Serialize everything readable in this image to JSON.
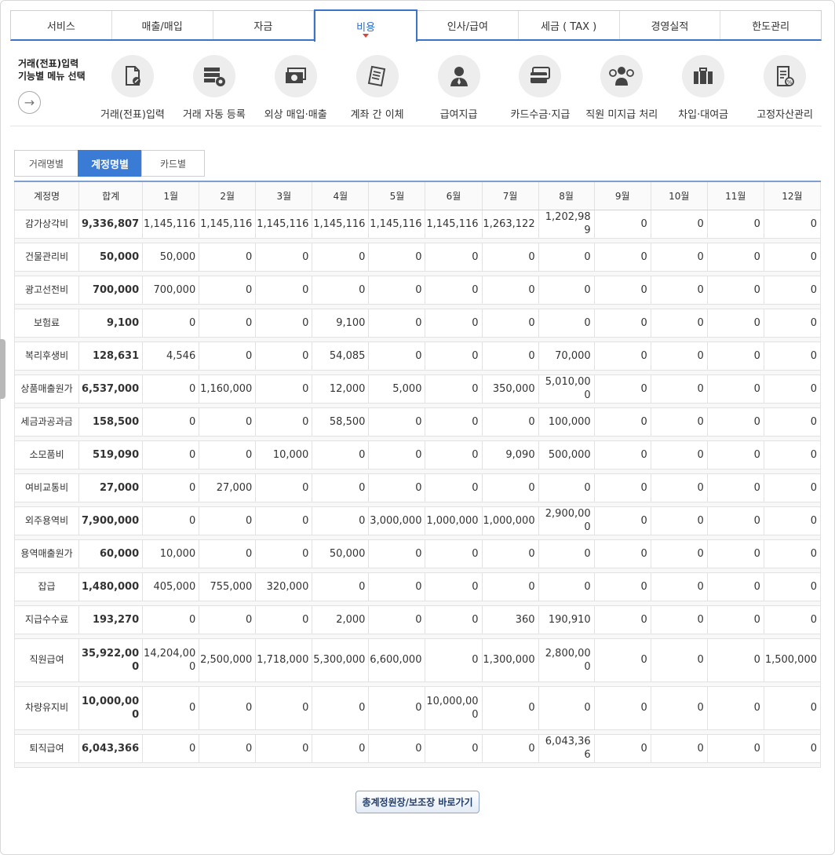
{
  "topnav": [
    {
      "label": "서비스",
      "active": false
    },
    {
      "label": "매출/매입",
      "active": false
    },
    {
      "label": "자금",
      "active": false
    },
    {
      "label": "비용",
      "active": true
    },
    {
      "label": "인사/급여",
      "active": false
    },
    {
      "label": "세금 ( TAX )",
      "active": false
    },
    {
      "label": "경영실적",
      "active": false
    },
    {
      "label": "한도관리",
      "active": false
    }
  ],
  "menu_intro": {
    "line1": "거래(전표)입력",
    "line2": "기능별 메뉴 선택"
  },
  "functions": [
    {
      "label": "거래(전표)입력",
      "icon": "document-pen-icon"
    },
    {
      "label": "거래 자동 등록",
      "icon": "server-gear-icon"
    },
    {
      "label": "외상 매입·매출",
      "icon": "cash-icon"
    },
    {
      "label": "계좌 간 이체",
      "icon": "receipt-icon"
    },
    {
      "label": "급여지급",
      "icon": "person-icon"
    },
    {
      "label": "카드수금·지급",
      "icon": "credit-card-icon"
    },
    {
      "label": "직원 미지급 처리",
      "icon": "employee-money-icon"
    },
    {
      "label": "차입·대여금",
      "icon": "briefcase-icon"
    },
    {
      "label": "고정자산관리",
      "icon": "asset-document-icon"
    }
  ],
  "subtabs": [
    {
      "label": "거래명별",
      "active": false
    },
    {
      "label": "계정명별",
      "active": true
    },
    {
      "label": "카드별",
      "active": false
    }
  ],
  "table": {
    "headers": [
      "계정명",
      "합계",
      "1월",
      "2월",
      "3월",
      "4월",
      "5월",
      "6월",
      "7월",
      "8월",
      "9월",
      "10월",
      "11월",
      "12월"
    ],
    "rows": [
      [
        "감가상각비",
        "9,336,807",
        "1,145,116",
        "1,145,116",
        "1,145,116",
        "1,145,116",
        "1,145,116",
        "1,145,116",
        "1,263,122",
        "1,202,989",
        "0",
        "0",
        "0",
        "0"
      ],
      [
        "건물관리비",
        "50,000",
        "50,000",
        "0",
        "0",
        "0",
        "0",
        "0",
        "0",
        "0",
        "0",
        "0",
        "0",
        "0"
      ],
      [
        "광고선전비",
        "700,000",
        "700,000",
        "0",
        "0",
        "0",
        "0",
        "0",
        "0",
        "0",
        "0",
        "0",
        "0",
        "0"
      ],
      [
        "보험료",
        "9,100",
        "0",
        "0",
        "0",
        "9,100",
        "0",
        "0",
        "0",
        "0",
        "0",
        "0",
        "0",
        "0"
      ],
      [
        "복리후생비",
        "128,631",
        "4,546",
        "0",
        "0",
        "54,085",
        "0",
        "0",
        "0",
        "70,000",
        "0",
        "0",
        "0",
        "0"
      ],
      [
        "상품매출원가",
        "6,537,000",
        "0",
        "1,160,000",
        "0",
        "12,000",
        "5,000",
        "0",
        "350,000",
        "5,010,000",
        "0",
        "0",
        "0",
        "0"
      ],
      [
        "세금과공과금",
        "158,500",
        "0",
        "0",
        "0",
        "58,500",
        "0",
        "0",
        "0",
        "100,000",
        "0",
        "0",
        "0",
        "0"
      ],
      [
        "소모품비",
        "519,090",
        "0",
        "0",
        "10,000",
        "0",
        "0",
        "0",
        "9,090",
        "500,000",
        "0",
        "0",
        "0",
        "0"
      ],
      [
        "여비교통비",
        "27,000",
        "0",
        "27,000",
        "0",
        "0",
        "0",
        "0",
        "0",
        "0",
        "0",
        "0",
        "0",
        "0"
      ],
      [
        "외주용역비",
        "7,900,000",
        "0",
        "0",
        "0",
        "0",
        "3,000,000",
        "1,000,000",
        "1,000,000",
        "2,900,000",
        "0",
        "0",
        "0",
        "0"
      ],
      [
        "용역매출원가",
        "60,000",
        "10,000",
        "0",
        "0",
        "50,000",
        "0",
        "0",
        "0",
        "0",
        "0",
        "0",
        "0",
        "0"
      ],
      [
        "잡급",
        "1,480,000",
        "405,000",
        "755,000",
        "320,000",
        "0",
        "0",
        "0",
        "0",
        "0",
        "0",
        "0",
        "0",
        "0"
      ],
      [
        "지급수수료",
        "193,270",
        "0",
        "0",
        "0",
        "2,000",
        "0",
        "0",
        "360",
        "190,910",
        "0",
        "0",
        "0",
        "0"
      ],
      [
        "직원급여",
        "35,922,000",
        "14,204,000",
        "2,500,000",
        "1,718,000",
        "5,300,000",
        "6,600,000",
        "0",
        "1,300,000",
        "2,800,000",
        "0",
        "0",
        "0",
        "1,500,000"
      ],
      [
        "차량유지비",
        "10,000,000",
        "0",
        "0",
        "0",
        "0",
        "0",
        "10,000,000",
        "0",
        "0",
        "0",
        "0",
        "0",
        "0"
      ],
      [
        "퇴직급여",
        "6,043,366",
        "0",
        "0",
        "0",
        "0",
        "0",
        "0",
        "0",
        "6,043,366",
        "0",
        "0",
        "0",
        "0"
      ]
    ]
  },
  "bottom_button": "총계정원장/보조장 바로가기"
}
